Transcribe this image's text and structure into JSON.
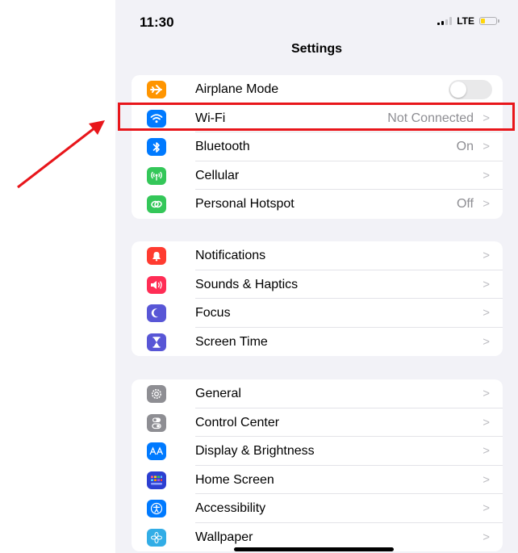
{
  "status_bar": {
    "time": "11:30",
    "network": "LTE"
  },
  "header": {
    "title": "Settings"
  },
  "groups": [
    [
      {
        "label": "Airplane Mode",
        "icon": "airplane-icon",
        "color": "#ff9500",
        "toggle": false
      },
      {
        "label": "Wi-Fi",
        "value": "Not Connected",
        "icon": "wifi-icon",
        "color": "#007aff"
      },
      {
        "label": "Bluetooth",
        "value": "On",
        "icon": "bluetooth-icon",
        "color": "#007aff"
      },
      {
        "label": "Cellular",
        "value": "",
        "icon": "cellular-icon",
        "color": "#34c759"
      },
      {
        "label": "Personal Hotspot",
        "value": "Off",
        "icon": "hotspot-icon",
        "color": "#34c759"
      }
    ],
    [
      {
        "label": "Notifications",
        "icon": "notifications-icon",
        "color": "#ff3b30"
      },
      {
        "label": "Sounds & Haptics",
        "icon": "sounds-icon",
        "color": "#ff2d55"
      },
      {
        "label": "Focus",
        "icon": "focus-moon-icon",
        "color": "#5856d6"
      },
      {
        "label": "Screen Time",
        "icon": "hourglass-icon",
        "color": "#5856d6"
      }
    ],
    [
      {
        "label": "General",
        "icon": "gear-icon",
        "color": "#8e8e93"
      },
      {
        "label": "Control Center",
        "icon": "control-center-icon",
        "color": "#8e8e93"
      },
      {
        "label": "Display & Brightness",
        "icon": "display-aa-icon",
        "color": "#007aff"
      },
      {
        "label": "Home Screen",
        "icon": "home-screen-grid-icon",
        "color": "#2c3fd1"
      },
      {
        "label": "Accessibility",
        "icon": "accessibility-icon",
        "color": "#007aff"
      },
      {
        "label": "Wallpaper",
        "icon": "wallpaper-icon",
        "color": "#32ade6"
      }
    ]
  ],
  "chevron": ">",
  "annotation": {
    "highlight_color": "#e8161b"
  }
}
